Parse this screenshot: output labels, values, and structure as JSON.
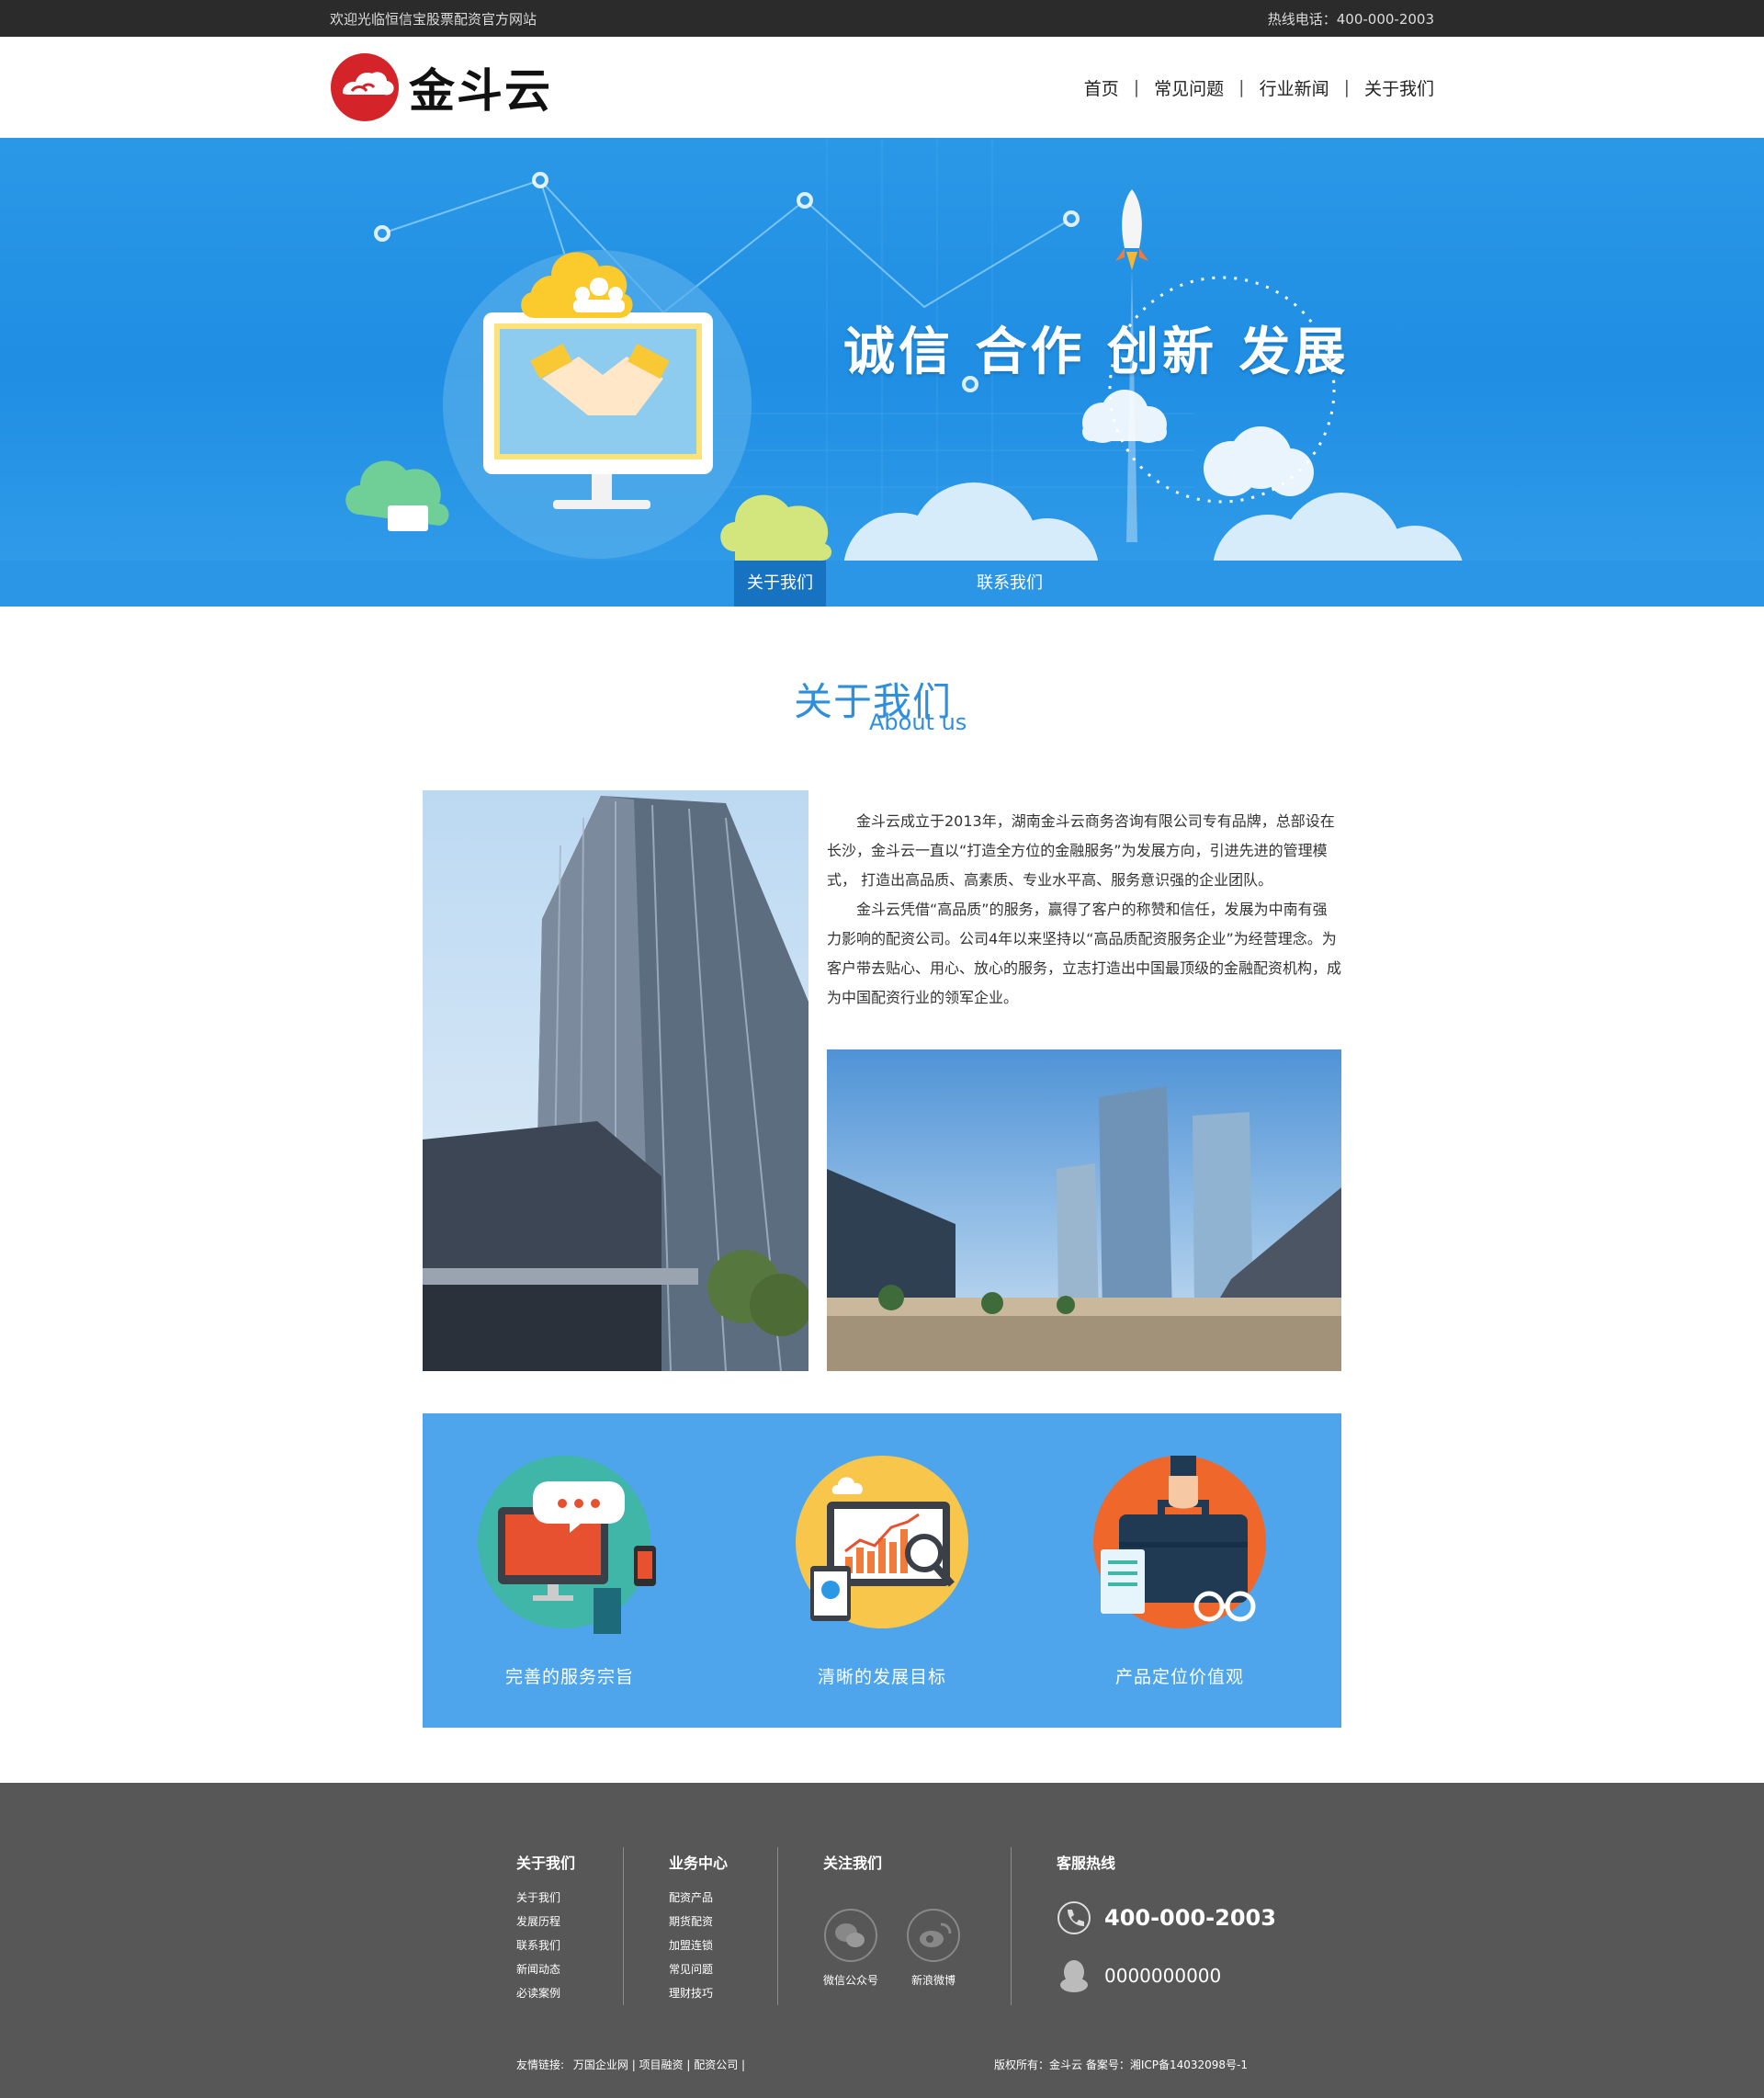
{
  "topbar": {
    "welcome": "欢迎光临恒信宝股票配资官方网站",
    "hotline": "热线电话：400-000-2003"
  },
  "header": {
    "logo_text": "金斗云",
    "nav": [
      "首页",
      "常见问题",
      "行业新闻",
      "关于我们"
    ],
    "nav_separator": "|"
  },
  "banner": {
    "slogan": "诚信 合作 创新 发展"
  },
  "subnav": {
    "items": [
      "关于我们",
      "联系我们"
    ],
    "active": "关于我们"
  },
  "about": {
    "title_cn": "关于我们",
    "title_en": "About us",
    "paragraphs": [
      "金斗云成立于2013年，湖南金斗云商务咨询有限公司专有品牌，总部设在长沙，金斗云一直以“打造全方位的金融服务”为发展方向，引进先进的管理模式， 打造出高品质、高素质、专业水平高、服务意识强的企业团队。",
      "金斗云凭借“高品质”的服务，赢得了客户的称赞和信任，发展为中南有强力影响的配资公司。公司4年以来坚持以“高品质配资服务企业”为经营理念。为客户带去贴心、用心、放心的服务，立志打造出中国最顶级的金融配资机构，成为中国配资行业的领军企业。"
    ]
  },
  "features": [
    {
      "label": "完善的服务宗旨",
      "icon": "computer-chat-icon"
    },
    {
      "label": "清晰的发展目标",
      "icon": "analytics-chart-icon"
    },
    {
      "label": "产品定位价值观",
      "icon": "briefcase-icon"
    }
  ],
  "footer": {
    "col1": {
      "title": "关于我们",
      "links": [
        "关于我们",
        "发展历程",
        "联系我们",
        "新闻动态",
        "必读案例"
      ]
    },
    "col2": {
      "title": "业务中心",
      "links": [
        "配资产品",
        "期货配资",
        "加盟连锁",
        "常见问题",
        "理财技巧"
      ]
    },
    "col3": {
      "title": "关注我们",
      "wechat": "微信公众号",
      "weibo": "新浪微博"
    },
    "col4": {
      "title": "客服热线",
      "phone": "400-000-2003",
      "qq": "0000000000"
    },
    "links_label": "友情链接:",
    "links": "万国企业网 | 项目融资 | 配资公司 |",
    "copyright": "版权所有：金斗云 备案号：湘ICP备14032098号-1"
  },
  "colors": {
    "topbar": "#2b2b2b",
    "banner": "#2b98e6",
    "subnav": "#2b95e6",
    "subnav_active": "#1772c2",
    "features_bg": "#4ea5ec",
    "footer_bg": "#575757",
    "title_blue": "#2f8fdc",
    "logo_red": "#d5232a"
  }
}
